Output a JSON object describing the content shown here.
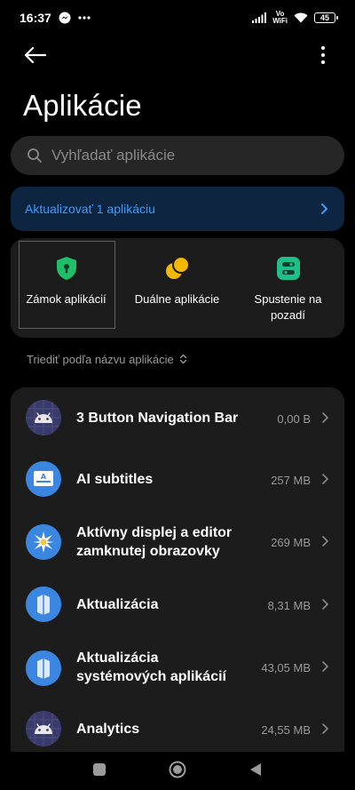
{
  "status_bar": {
    "time": "16:37",
    "vowifi_top": "Vo",
    "vowifi_bottom": "WiFi",
    "battery": "45"
  },
  "page": {
    "title": "Aplikácie"
  },
  "search": {
    "placeholder": "Vyhľadať aplikácie"
  },
  "update_banner": {
    "label": "Aktualizovať 1 aplikáciu"
  },
  "shortcuts": [
    {
      "label": "Zámok aplikácií",
      "icon": "shield-lock-icon",
      "color": "#1fbf6a"
    },
    {
      "label": "Duálne aplikácie",
      "icon": "dual-apps-icon",
      "color": "#f5b800"
    },
    {
      "label_line1": "Spustenie na",
      "label_line2": "pozadí",
      "icon": "autostart-icon",
      "color": "#1fbf8a"
    }
  ],
  "sort": {
    "label": "Triediť podľa názvu aplikácie"
  },
  "apps": [
    {
      "name": "3 Button Navigation Bar",
      "size": "0,00 B",
      "icon": "android-icon"
    },
    {
      "name": "AI subtitles",
      "size": "257 MB",
      "icon": "subtitles-icon"
    },
    {
      "name_line1": "Aktívny displej a editor",
      "name_line2": "zamknutej obrazovky",
      "size": "269 MB",
      "icon": "lockscreen-icon"
    },
    {
      "name": "Aktualizácia",
      "size": "8,31 MB",
      "icon": "update-icon"
    },
    {
      "name_line1": "Aktualizácia",
      "name_line2": "systémových aplikácií",
      "size": "43,05 MB",
      "icon": "system-update-icon"
    },
    {
      "name": "Analytics",
      "size": "24,55 MB",
      "icon": "android-icon"
    }
  ],
  "colors": {
    "accent_blue": "#3d9bff",
    "banner_bg": "#0d2540",
    "card_bg": "#1c1c1c"
  }
}
